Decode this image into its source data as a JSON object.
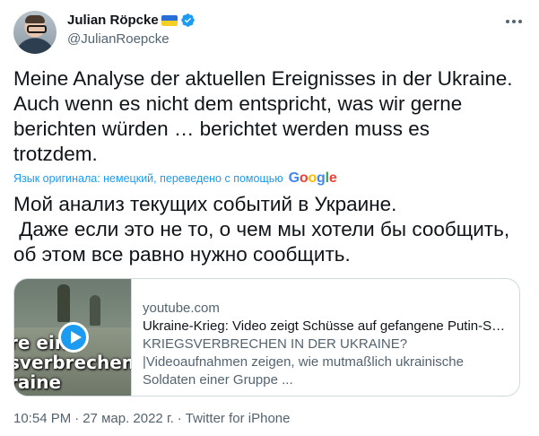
{
  "author": {
    "display_name": "Julian Röpcke",
    "handle": "@JulianRoepcke",
    "flag_icon": "ukraine-flag-icon",
    "verified_icon": "verified-badge-icon",
    "verified_color": "#1d9bf0"
  },
  "tweet": {
    "text": "Meine Analyse der aktuellen Ereignisses in der Ukraine.\nAuch wenn es nicht dem entspricht, was wir gerne\nberichten würden … berichtet werden muss es\ntrotzdem.",
    "translation_note": "Язык оригинала: немецкий, переведено с помощью",
    "translation_provider_logo": "Google",
    "translated_text": "Мой анализ текущих событий в Украине.\n Даже если это не то, о чем мы хотели бы сообщить,\nоб этом все равно нужно сообщить."
  },
  "link_card": {
    "domain": "youtube.com",
    "title": "Ukraine-Krieg: Video zeigt Schüsse auf gefangene Putin-Sol...",
    "description": "KRIEGSVERBRECHEN IN DER UKRAINE?|Videoaufnahmen zeigen, wie mutmaßlich ukrainische Soldaten einer Gruppe ...",
    "thumbnail_text": "re ein\nsverbrechen\nraine",
    "play_icon": "play-icon"
  },
  "meta": {
    "time": "10:54 PM",
    "separator": "·",
    "date": "27 мар. 2022 г.",
    "source": "Twitter for iPhone"
  }
}
